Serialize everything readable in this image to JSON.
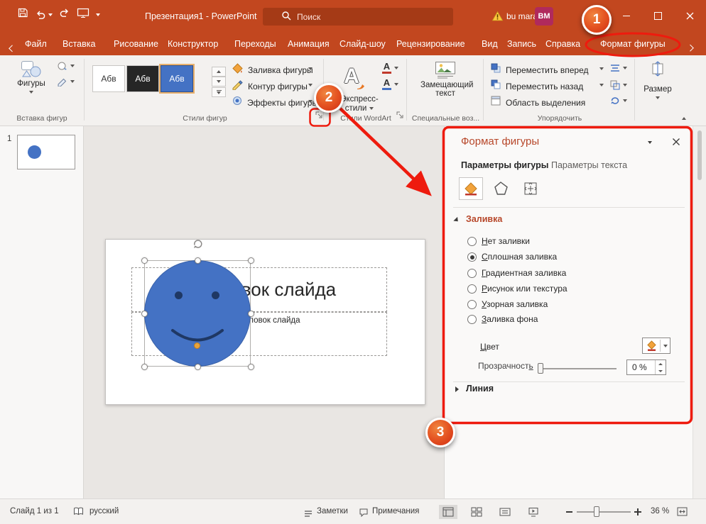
{
  "app": {
    "title": "Презентация1 - PowerPoint"
  },
  "titlebar": {
    "search_placeholder": "Поиск",
    "user_name": "bu mara",
    "avatar_initials": "BM"
  },
  "tabs": [
    "Файл",
    "Вставка",
    "Рисование",
    "Конструктор",
    "Переходы",
    "Анимация",
    "Слайд-шоу",
    "Рецензирование",
    "Вид",
    "Запись",
    "Справка",
    "Формат фигуры"
  ],
  "ribbon": {
    "shapes_label": "Фигуры",
    "swatch_text": "Абв",
    "fill_label": "Заливка фигуры",
    "outline_label": "Контур фигуры",
    "effects_label": "Эффекты фигуры",
    "wordart_letter": "А",
    "text_fill_letter": "А",
    "text_outline_letter": "А",
    "quick_styles_line1": "Экспресс-",
    "quick_styles_line2": "стили",
    "alt_text_line1": "Замещающий",
    "alt_text_line2": "текст",
    "bring_forward_label": "Переместить вперед",
    "send_backward_label": "Переместить назад",
    "selection_pane_label": "Область выделения",
    "size_label": "Размер",
    "group_insert_shapes": "Вставка фигур",
    "group_shape_styles": "Стили фигур",
    "group_wordart": "Стили WordArt",
    "group_accessibility": "Специальные воз...",
    "group_arrange": "Упорядочить"
  },
  "thumbnails": {
    "slide_number": "1"
  },
  "slide": {
    "title_placeholder": "Заголовок слайда",
    "subtitle_placeholder": "Подзаголовок слайда"
  },
  "pane": {
    "title": "Формат фигуры",
    "tab_shape": "Параметры фигуры",
    "tab_text": "Параметры текста",
    "section_fill": "Заливка",
    "section_line": "Линия",
    "options": [
      {
        "key": "Н",
        "rest": "ет заливки"
      },
      {
        "key": "С",
        "rest": "плошная заливка"
      },
      {
        "key": "Г",
        "rest": "радиентная заливка"
      },
      {
        "key": "Р",
        "rest": "исунок или текстура"
      },
      {
        "key": "У",
        "rest": "зорная заливка"
      },
      {
        "key": "З",
        "rest": "аливка фона"
      }
    ],
    "color_key": "Ц",
    "color_rest": "вет",
    "transparency_head": "Прозрачност",
    "transparency_key": "ь",
    "transparency_value": "0 %"
  },
  "statusbar": {
    "slide_indicator": "Слайд 1 из 1",
    "language": "русский",
    "notes_label": "Заметки",
    "comments_label": "Примечания",
    "zoom_value": "36 %"
  },
  "annotations": {
    "step1": "1",
    "step2": "2",
    "step3": "3"
  },
  "colors": {
    "titlebar_bg": "#c2471f",
    "annotation_red": "#ee1b0e",
    "shape_fill": "#4472c4",
    "shape_features": "#1f3864",
    "adjust_handle": "#e8a33d",
    "pane_accent": "#b7472a"
  }
}
